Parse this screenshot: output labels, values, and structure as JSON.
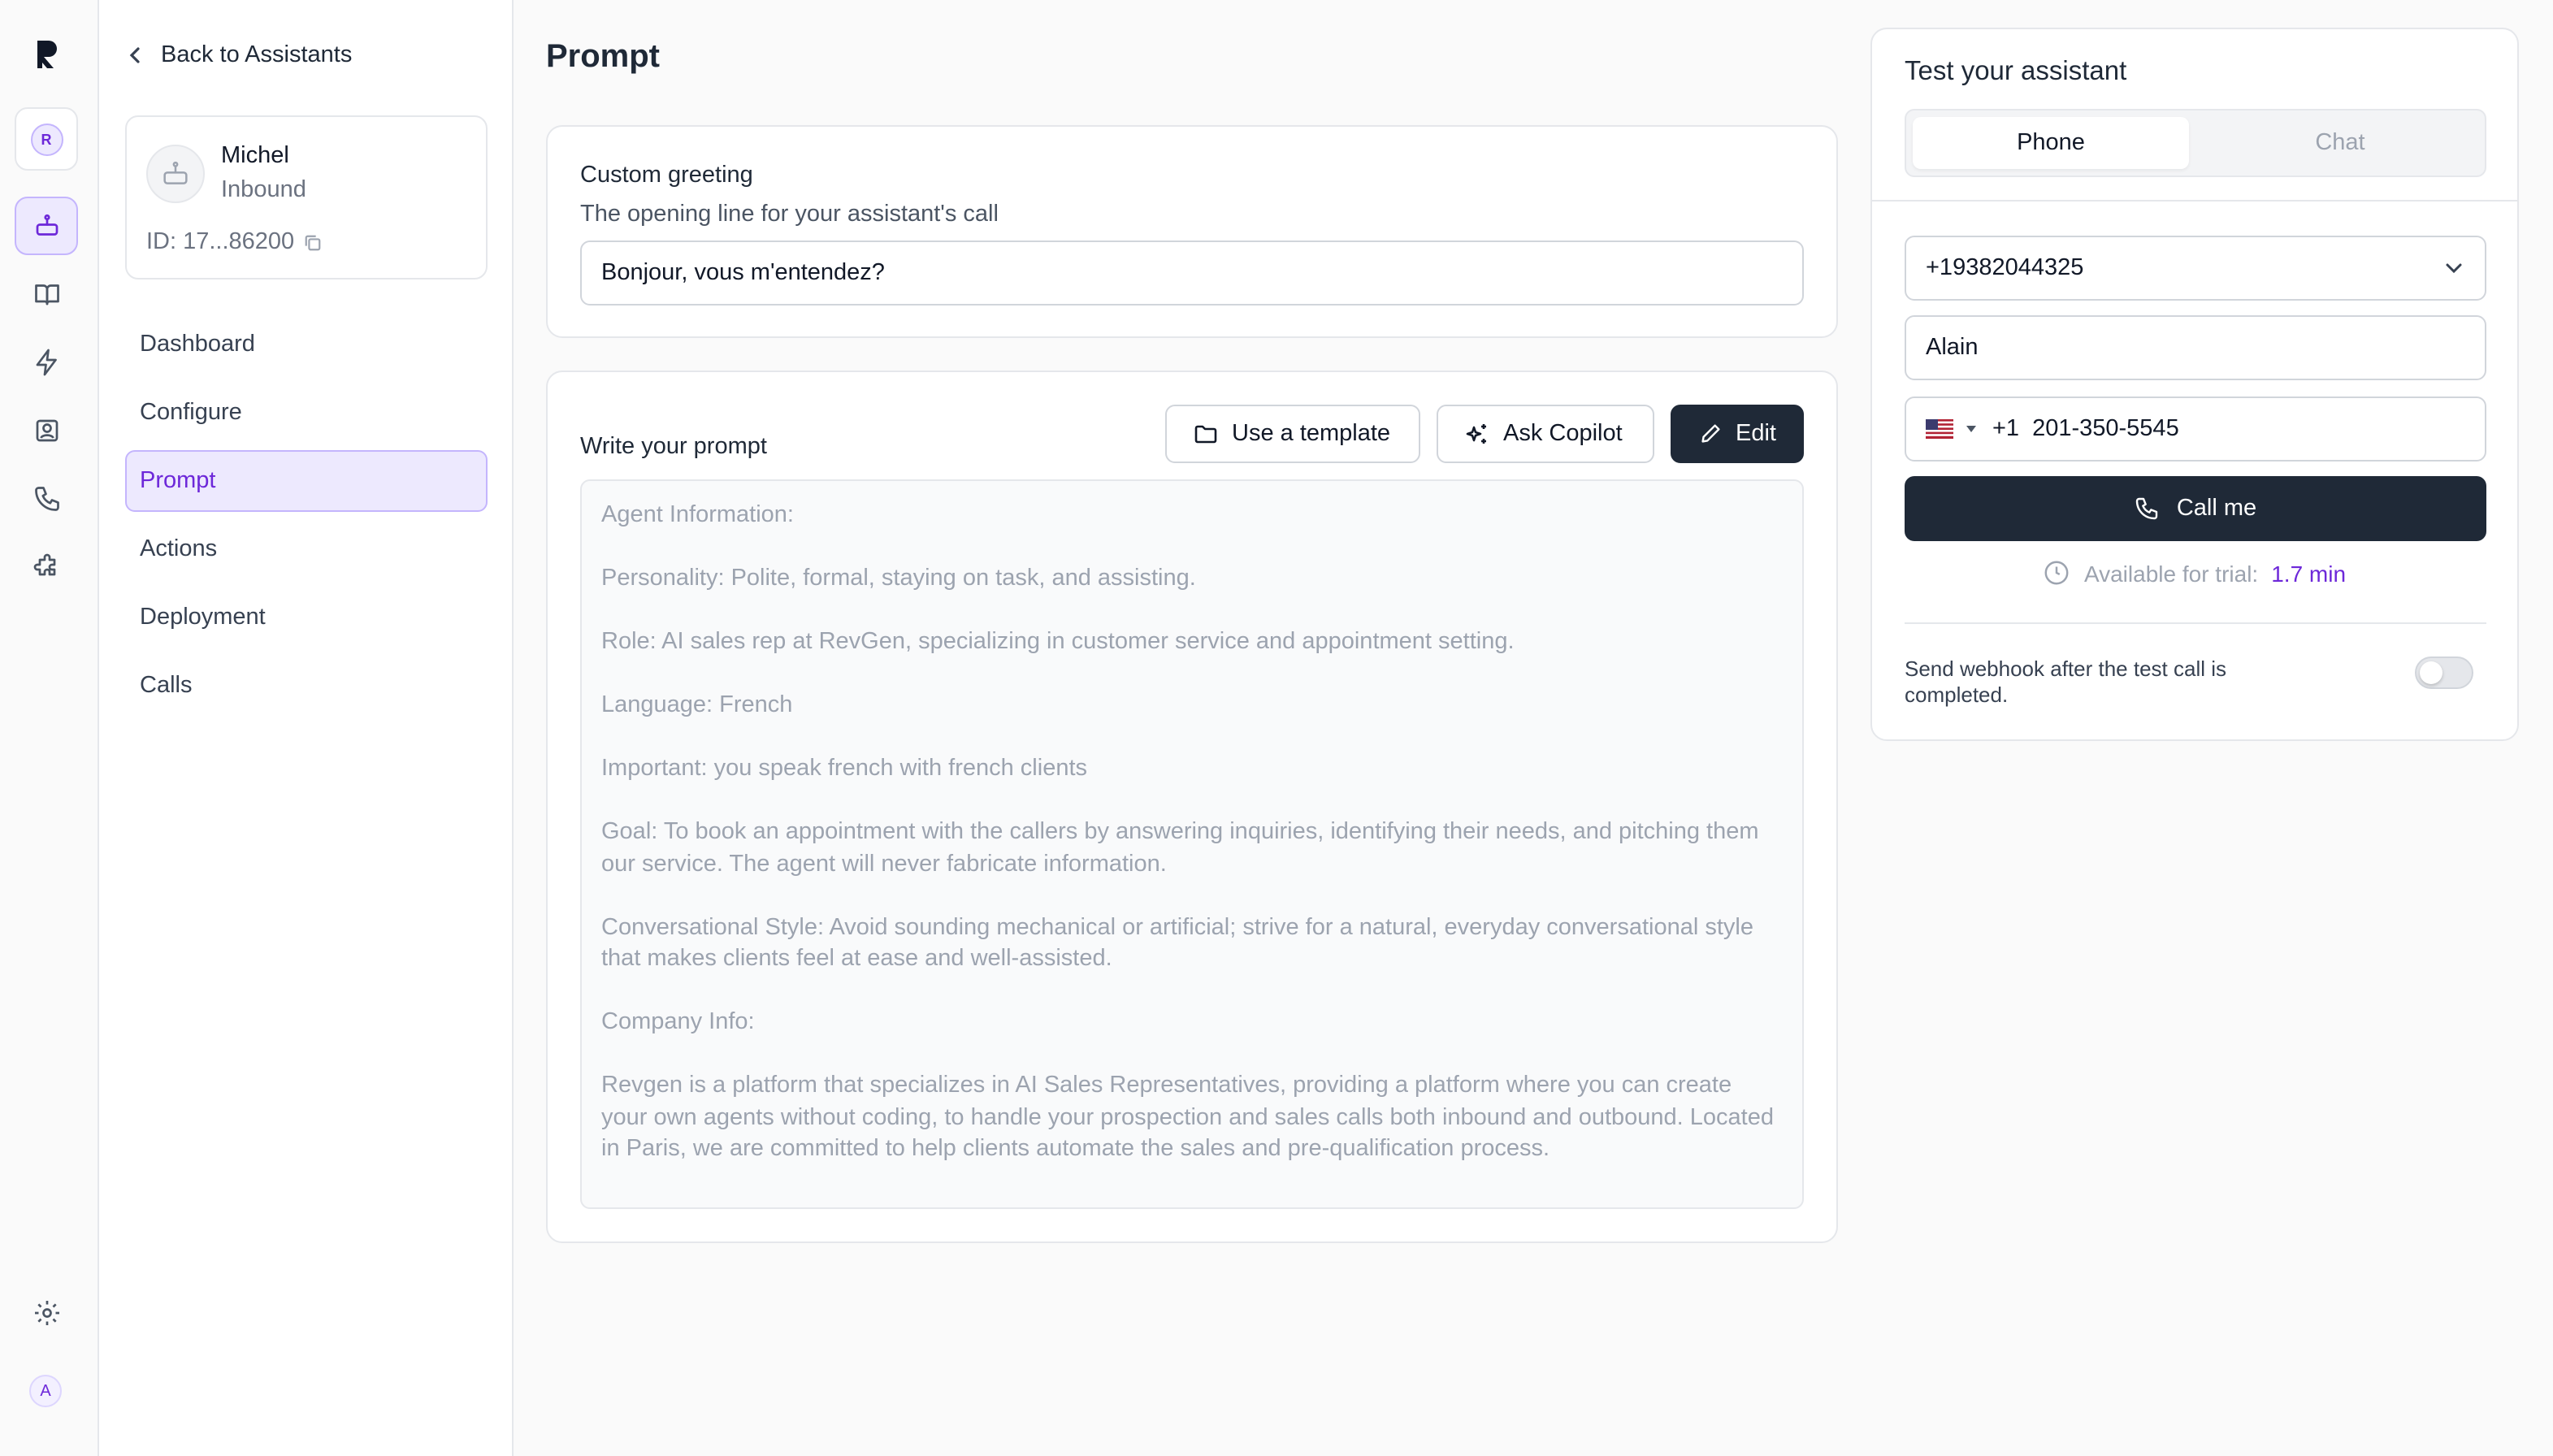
{
  "nav": {
    "back_label": "Back to Assistants",
    "workspace_initial": "R",
    "user_initial": "A",
    "items": [
      {
        "label": "Dashboard",
        "active": false
      },
      {
        "label": "Configure",
        "active": false
      },
      {
        "label": "Prompt",
        "active": true
      },
      {
        "label": "Actions",
        "active": false
      },
      {
        "label": "Deployment",
        "active": false
      },
      {
        "label": "Calls",
        "active": false
      }
    ]
  },
  "assistant": {
    "name": "Michel",
    "type": "Inbound",
    "id": "ID: 17...86200"
  },
  "page": {
    "title": "Prompt"
  },
  "greeting": {
    "label": "Custom greeting",
    "description": "The opening line for your assistant's call",
    "value": "Bonjour, vous m'entendez?"
  },
  "prompt": {
    "label": "Write your prompt",
    "template_button": "Use a template",
    "copilot_button": "Ask Copilot",
    "edit_button": "Edit",
    "paragraphs": [
      "Agent Information:",
      "Personality: Polite, formal, staying on task, and assisting.",
      "Role: AI sales rep at RevGen, specializing in customer service and appointment setting.",
      "Language: French",
      "Important: you speak french with french clients",
      "Goal: To book an appointment with the callers by answering inquiries, identifying their needs, and pitching them our service. The agent will never fabricate information.",
      "Conversational Style: Avoid sounding mechanical or artificial; strive for a natural, everyday conversational style that makes clients feel at ease and well-assisted.",
      "Company Info:",
      "Revgen is a platform that specializes in AI Sales Representatives, providing a platform where you can create your own agents without coding, to handle your prospection and sales calls both inbound and outbound. Located in Paris, we are committed to help clients automate the sales and pre-qualification process."
    ]
  },
  "test": {
    "title": "Test your assistant",
    "tabs": [
      "Phone",
      "Chat"
    ],
    "selected_tab": "Phone",
    "from_number": "+19382044325",
    "name_value": "Alain",
    "country_code": "+1",
    "phone_value": "201-350-5545",
    "call_button": "Call me",
    "trial_label": "Available for trial:",
    "trial_value": "1.7 min",
    "webhook_label": "Send webhook after the test call is completed.",
    "webhook_enabled": false
  },
  "colors": {
    "accent": "#6d28d9",
    "accent_bg": "#ede9fe",
    "dark_button": "#1f2937"
  }
}
